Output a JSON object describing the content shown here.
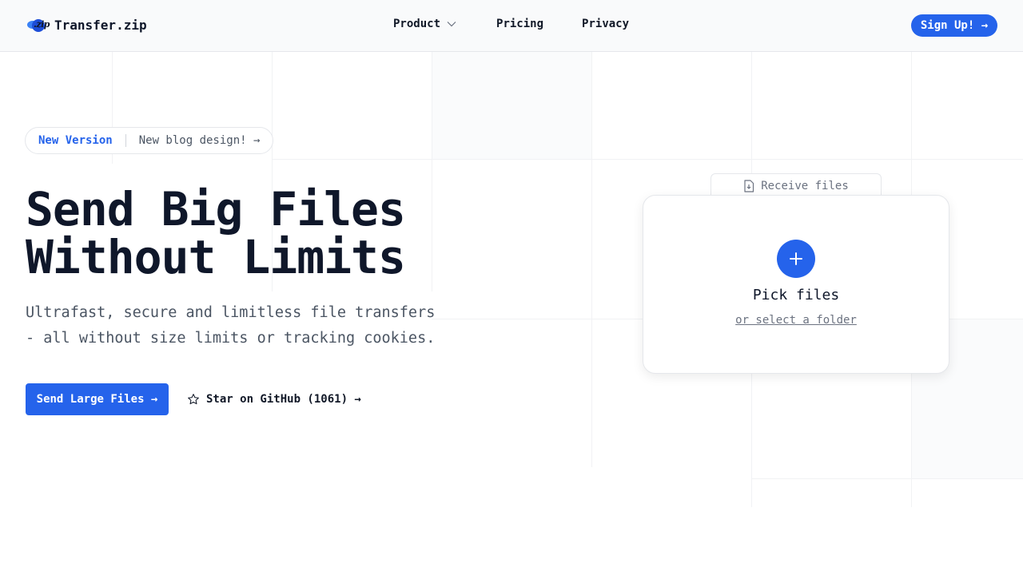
{
  "header": {
    "logo_badge": ".zip",
    "logo_text": "Transfer.zip",
    "nav": [
      {
        "label": "Product",
        "has_dropdown": true
      },
      {
        "label": "Pricing"
      },
      {
        "label": "Privacy"
      }
    ],
    "signup_label": "Sign Up! →"
  },
  "announcement": {
    "tag": "New Version",
    "message": "New blog design! →"
  },
  "hero": {
    "title_line1": "Send Big Files",
    "title_line2": "Without Limits",
    "subtitle": "Ultrafast, secure and limitless file transfers - all without size limits or tracking cookies.",
    "primary_cta": "Send Large Files →",
    "github_cta": "Star on GitHub (1061) →"
  },
  "upload": {
    "receive_tab": "Receive files",
    "pick_label": "Pick files",
    "folder_link": "or select a folder"
  },
  "colors": {
    "accent": "#2563eb",
    "text": "#0f172a",
    "muted": "#4b5563",
    "border": "#e5e7eb"
  },
  "icons": [
    "logo-icon",
    "chevron-down-icon",
    "star-icon",
    "document-download-icon",
    "plus-icon"
  ]
}
